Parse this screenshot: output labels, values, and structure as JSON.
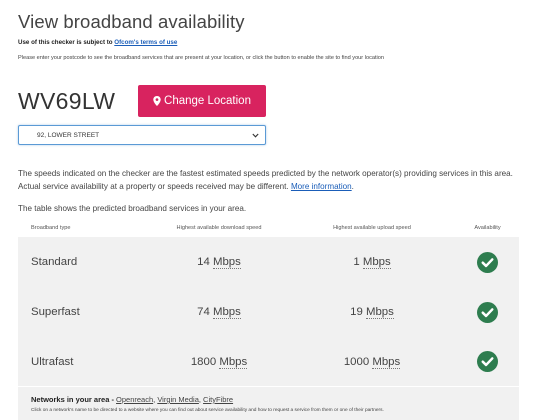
{
  "page": {
    "title": "View broadband availability",
    "terms_prefix": "Use of this checker is subject to ",
    "terms_link": "Ofcom's terms of use",
    "instructions": "Please enter your postcode to see the broadband services that are present at your location, or click the button to enable the site to find your location"
  },
  "location": {
    "postcode": "WV69LW",
    "change_button": "Change Location",
    "address_selected": "92, LOWER STREET"
  },
  "notes": {
    "speeds_text": "The speeds indicated on the checker are the fastest estimated speeds predicted by the network operator(s) providing services in this area. Actual service availability at a property or speeds received may be different. ",
    "more_info_link": "More information",
    "speeds_end": ".",
    "table_intro": "The table shows the predicted broadband services in your area."
  },
  "table": {
    "headers": [
      "Broadband type",
      "Highest available download speed",
      "Highest available upload speed",
      "Availability"
    ],
    "rows": [
      {
        "type": "Standard",
        "down_value": "14",
        "down_unit": "Mbps",
        "up_value": "1",
        "up_unit": "Mbps",
        "available": true
      },
      {
        "type": "Superfast",
        "down_value": "74",
        "down_unit": "Mbps",
        "up_value": "19",
        "up_unit": "Mbps",
        "available": true
      },
      {
        "type": "Ultrafast",
        "down_value": "1800",
        "down_unit": "Mbps",
        "up_value": "1000",
        "up_unit": "Mbps",
        "available": true
      }
    ]
  },
  "networks": {
    "label": "Networks in your area - ",
    "links": [
      "Openreach",
      "Virgin Media",
      "CityFibre"
    ],
    "separator": ", ",
    "note": "Click on a network's name to be directed to a website where you can find out about service availability and how to request a service from them or one of their partners."
  },
  "colors": {
    "accent": "#d8235f",
    "link": "#1a5db8",
    "check": "#2e7d4f",
    "table_bg": "#f1f1f1"
  },
  "icons": {
    "change_button_icon": "map-marker-icon",
    "select_icon": "chevron-down-icon",
    "availability_icon": "check-circle-icon"
  }
}
